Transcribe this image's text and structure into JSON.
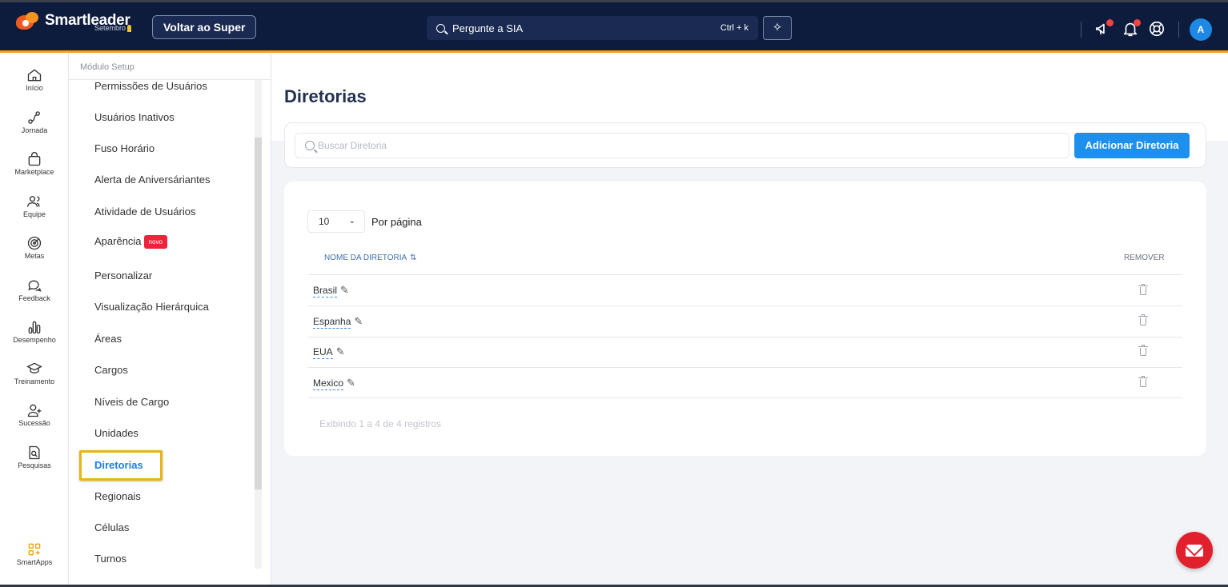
{
  "topbar": {
    "brand": "Smartleader",
    "brand_sub": "Setembro",
    "back_button": "Voltar ao Super",
    "search_text": "Pergunte a SIA",
    "search_shortcut": "Ctrl + k",
    "avatar_initial": "A",
    "icons": [
      "megaphone-icon",
      "bell-icon",
      "help-lifebuoy-icon",
      "sparkle-icon"
    ],
    "accent": "#f0a21a",
    "bg": "#0d1b3d"
  },
  "rail": {
    "items": [
      {
        "label": "Início",
        "icon": "home-icon"
      },
      {
        "label": "Jornada",
        "icon": "journey-icon"
      },
      {
        "label": "Marketplace",
        "icon": "bag-icon"
      },
      {
        "label": "Equipe",
        "icon": "team-icon"
      },
      {
        "label": "Metas",
        "icon": "target-icon"
      },
      {
        "label": "Feedback",
        "icon": "chat-icon"
      },
      {
        "label": "Desempenho",
        "icon": "bars-icon"
      },
      {
        "label": "Treinamento",
        "icon": "graduation-cap-icon"
      },
      {
        "label": "Sucessão",
        "icon": "user-plus-icon"
      },
      {
        "label": "Pesquisas",
        "icon": "search-document-icon"
      }
    ],
    "apps_label": "SmartApps"
  },
  "submenu": {
    "header": "Módulo Setup",
    "items": [
      {
        "label": "Permissões de Usuários"
      },
      {
        "label": "Usuários Inativos"
      },
      {
        "label": "Fuso Horário"
      },
      {
        "label": "Alerta de Aniversáriantes"
      },
      {
        "label": "Atividade de Usuários"
      },
      {
        "label": "Aparência",
        "badge": "novo"
      },
      {
        "label": "Personalizar"
      },
      {
        "label": "Visualização Hierárquica"
      },
      {
        "label": "Áreas"
      },
      {
        "label": "Cargos"
      },
      {
        "label": "Níveis de Cargo"
      },
      {
        "label": "Unidades"
      },
      {
        "label": "Diretorias",
        "active": true
      },
      {
        "label": "Regionais"
      },
      {
        "label": "Células"
      },
      {
        "label": "Turnos"
      }
    ]
  },
  "main": {
    "title": "Diretorias",
    "search_placeholder": "Buscar Diretoria",
    "add_button": "Adicionar Diretoria",
    "per_page_value": "10",
    "per_page_label": "Por página",
    "col_name": "NOME DA DIRETORIA",
    "col_remove": "REMOVER",
    "rows": [
      {
        "name": "Brasil"
      },
      {
        "name": "Espanha"
      },
      {
        "name": "EUA"
      },
      {
        "name": "Mexico"
      }
    ],
    "footer": "Exibindo 1 a 4 de 4 registros",
    "primary_color": "#1d8fec"
  }
}
